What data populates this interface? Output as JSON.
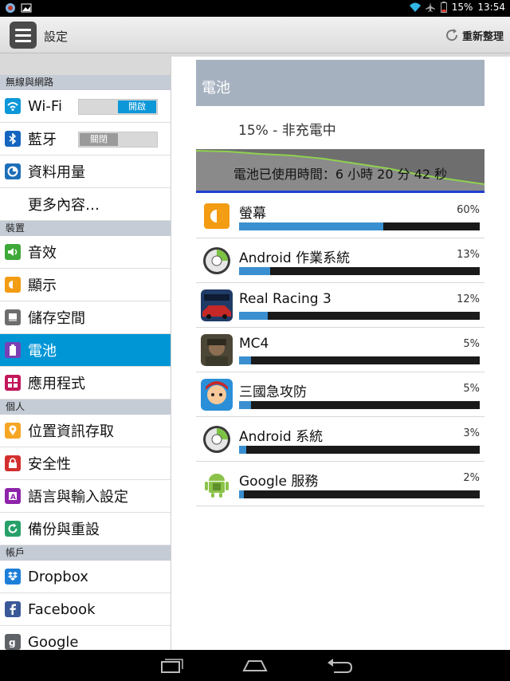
{
  "status_bar": {
    "battery": "15%",
    "time": "13:54"
  },
  "action_bar": {
    "title": "設定",
    "refresh_label": "重新整理"
  },
  "sidebar": {
    "sections": [
      {
        "header": "無線與網路",
        "items": [
          {
            "label": "Wi-Fi",
            "icon": "wifi-icon",
            "color": "#0b97d8",
            "toggle": "開啟",
            "toggle_state": "on"
          },
          {
            "label": "藍牙",
            "icon": "bluetooth-icon",
            "color": "#1565c0",
            "toggle": "關閉",
            "toggle_state": "off"
          },
          {
            "label": "資料用量",
            "icon": "data-usage-icon",
            "color": "#1e6fb8"
          },
          {
            "label": "更多內容…",
            "icon": ""
          }
        ]
      },
      {
        "header": "裝置",
        "items": [
          {
            "label": "音效",
            "icon": "sound-icon",
            "color": "#3fa83a"
          },
          {
            "label": "顯示",
            "icon": "display-icon",
            "color": "#f39c12"
          },
          {
            "label": "儲存空間",
            "icon": "storage-icon",
            "color": "#6d6d6d"
          },
          {
            "label": "電池",
            "icon": "battery-icon",
            "color": "#7b3fb5",
            "selected": true
          },
          {
            "label": "應用程式",
            "icon": "apps-icon",
            "color": "#c2185b"
          }
        ]
      },
      {
        "header": "個人",
        "items": [
          {
            "label": "位置資訊存取",
            "icon": "location-icon",
            "color": "#f5a623"
          },
          {
            "label": "安全性",
            "icon": "lock-icon",
            "color": "#d32f2f"
          },
          {
            "label": "語言與輸入設定",
            "icon": "language-icon",
            "color": "#8e24aa"
          },
          {
            "label": "備份與重設",
            "icon": "backup-icon",
            "color": "#27a06a"
          }
        ]
      },
      {
        "header": "帳戶",
        "items": [
          {
            "label": "Dropbox",
            "icon": "dropbox-icon",
            "color": "#1e7fd8"
          },
          {
            "label": "Facebook",
            "icon": "facebook-icon",
            "color": "#3b5998"
          },
          {
            "label": "Google",
            "icon": "google-icon",
            "color": "#5f6368"
          }
        ]
      }
    ]
  },
  "battery_panel": {
    "header": "電池",
    "status": "15% - 非充電中",
    "usage_time": "電池已使用時間：6 小時 20 分 42 秒",
    "usage": [
      {
        "name": "螢幕",
        "percent_label": "60%",
        "percent": 60,
        "icon": "screen-brightness-icon"
      },
      {
        "name": "Android 作業系統",
        "percent_label": "13%",
        "percent": 13,
        "icon": "android-os-icon"
      },
      {
        "name": "Real Racing 3",
        "percent_label": "12%",
        "percent": 12,
        "icon": "real-racing-3-icon"
      },
      {
        "name": "MC4",
        "percent_label": "5%",
        "percent": 5,
        "icon": "mc4-icon"
      },
      {
        "name": "三國急攻防",
        "percent_label": "5%",
        "percent": 5,
        "icon": "three-kingdoms-icon"
      },
      {
        "name": "Android 系統",
        "percent_label": "3%",
        "percent": 3,
        "icon": "android-system-icon"
      },
      {
        "name": "Google 服務",
        "percent_label": "2%",
        "percent": 2,
        "icon": "google-services-icon"
      }
    ]
  }
}
